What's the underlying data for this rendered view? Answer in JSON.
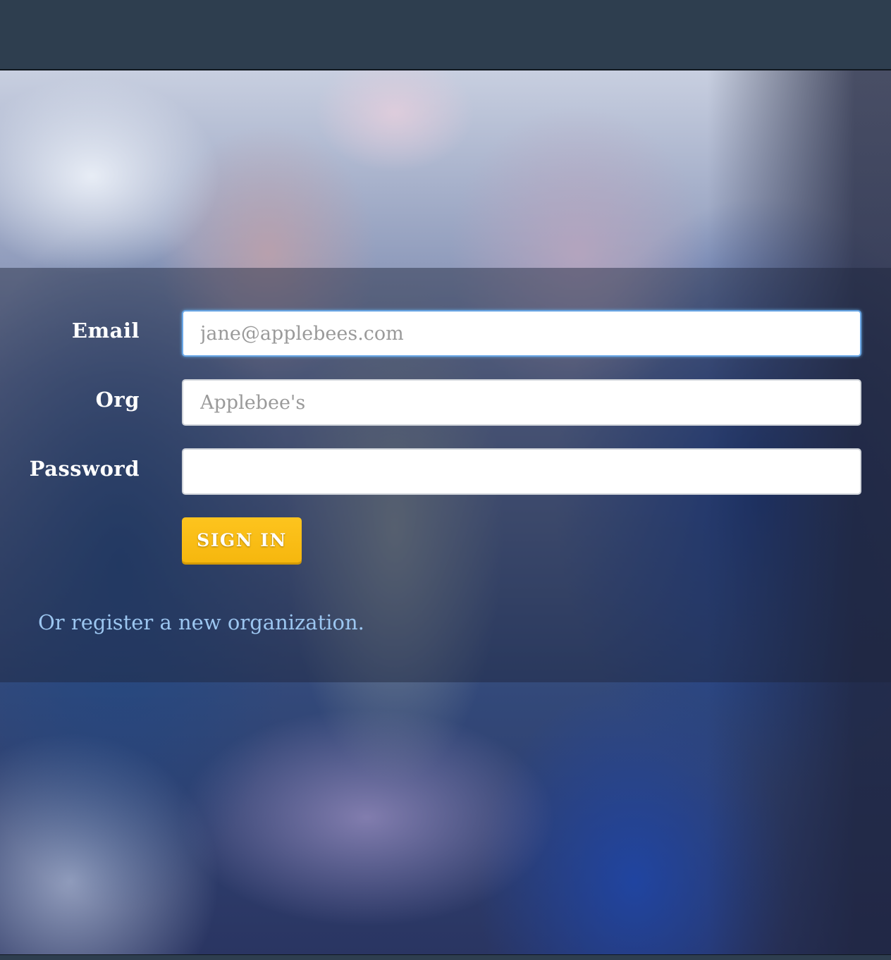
{
  "login_form": {
    "email": {
      "label": "Email",
      "placeholder": "jane@applebees.com",
      "value": ""
    },
    "org": {
      "label": "Org",
      "placeholder": "Applebee's",
      "value": ""
    },
    "password": {
      "label": "Password",
      "placeholder": "",
      "value": ""
    },
    "sign_in_label": "SIGN IN",
    "register_text": "Or register a new organization."
  },
  "colors": {
    "top_bar": "#2e3e4f",
    "button": "#fdc41e",
    "link": "#9cc6f0",
    "focus_border": "#6aa7e6"
  }
}
